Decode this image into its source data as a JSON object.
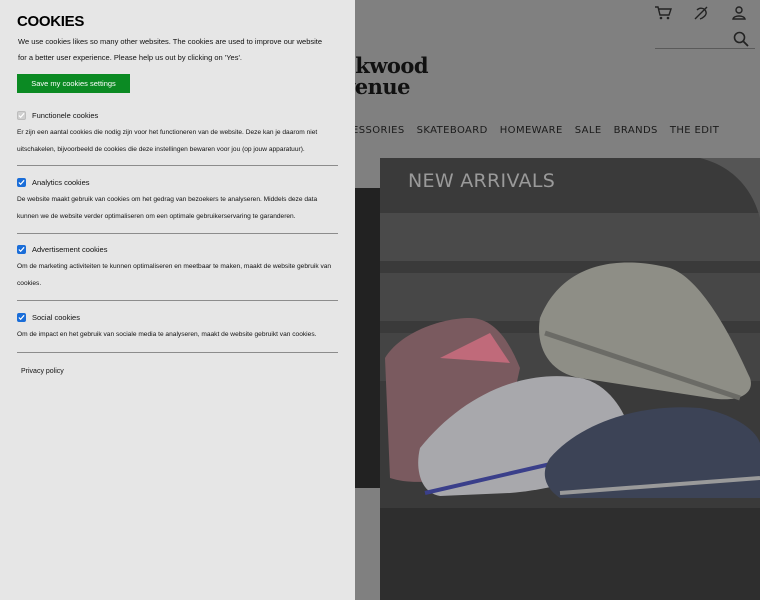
{
  "cookie_panel": {
    "title": "COOKIES",
    "intro": "We use cookies likes so many other websites. The cookies are used to improve our website for a better user experience. Please help us out by clicking on 'Yes'.",
    "save_label": "Save my cookies settings",
    "sections": [
      {
        "label": "Functionele cookies",
        "checked": true,
        "disabled": true,
        "description": "Er zijn een aantal cookies die nodig zijn voor het functioneren van de website. Deze kan je daarom niet uitschakelen, bijvoorbeeld de cookies die deze instellingen bewaren voor jou (op jouw apparatuur)."
      },
      {
        "label": "Analytics cookies",
        "checked": true,
        "disabled": false,
        "description": "De website maakt gebruik van cookies om het gedrag van bezoekers te analyseren. Middels deze data kunnen we de website verder optimaliseren om een optimale gebruikerservaring te garanderen."
      },
      {
        "label": "Advertisement cookies",
        "checked": true,
        "disabled": false,
        "description": "Om de marketing activiteiten te kunnen optimaliseren en meetbaar te maken, maakt de website gebruik van cookies."
      },
      {
        "label": "Social cookies",
        "checked": true,
        "disabled": false,
        "description": "Om de impact en het gebruik van sociale media te analyseren, maakt de website gebruikt van cookies."
      }
    ],
    "privacy_link": "Privacy policy"
  },
  "site": {
    "logo_line1": "ckwood",
    "logo_line2": "venue",
    "nav": [
      "ESSORIES",
      "SKATEBOARD",
      "HOMEWARE",
      "SALE",
      "BRANDS",
      "THE EDIT"
    ],
    "hero_title": "NEW ARRIVALS",
    "icons": [
      "cart-icon",
      "wishlist-icon",
      "account-icon",
      "search-icon"
    ]
  },
  "colors": {
    "save_button": "#0b8a23",
    "checkbox": "#1a6dd8",
    "panel_bg": "#e6e6e6",
    "overlay": "#808080"
  }
}
